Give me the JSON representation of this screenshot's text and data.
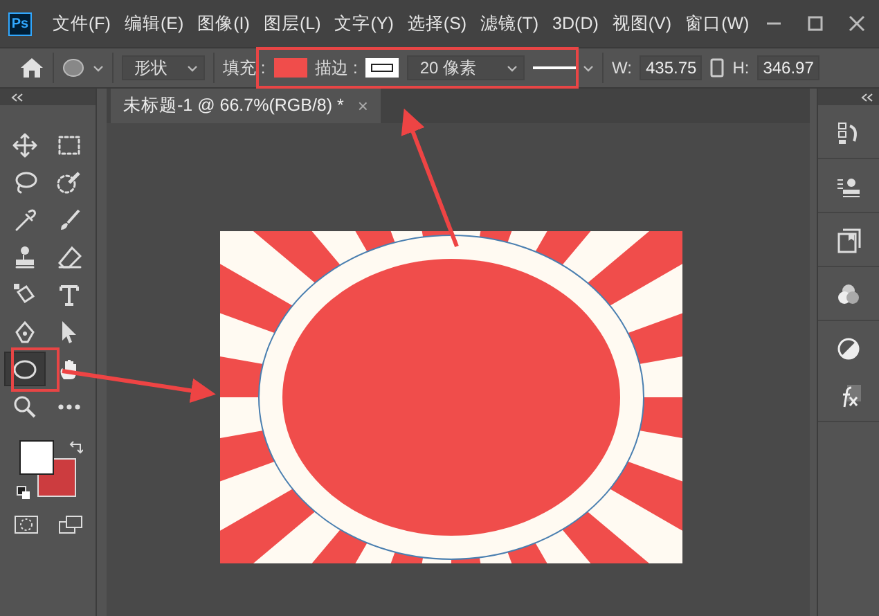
{
  "app": {
    "logo": "Ps"
  },
  "menu": [
    "文件(F)",
    "编辑(E)",
    "图像(I)",
    "图层(L)",
    "文字(Y)",
    "选择(S)",
    "滤镜(T)",
    "3D(D)",
    "视图(V)",
    "窗口(W)"
  ],
  "options_bar": {
    "shape_mode": "形状",
    "fill_label": "填充 :",
    "stroke_label": "描边 :",
    "stroke_width": "20 像素",
    "w_label": "W:",
    "w_value": "435.75",
    "h_label": "H:",
    "h_value": "346.97"
  },
  "tools": [
    {
      "kind": "move",
      "selected": false
    },
    {
      "kind": "marquee",
      "selected": false
    },
    {
      "kind": "lasso",
      "selected": false
    },
    {
      "kind": "quick-select",
      "selected": false
    },
    {
      "kind": "eyedropper",
      "selected": false
    },
    {
      "kind": "brush",
      "selected": false
    },
    {
      "kind": "stamp",
      "selected": false
    },
    {
      "kind": "eraser",
      "selected": false
    },
    {
      "kind": "bucket",
      "selected": false
    },
    {
      "kind": "text",
      "selected": false
    },
    {
      "kind": "pen",
      "selected": false
    },
    {
      "kind": "pointer",
      "selected": false
    },
    {
      "kind": "ellipse",
      "selected": true
    },
    {
      "kind": "hand",
      "selected": false
    },
    {
      "kind": "zoom",
      "selected": false
    },
    {
      "kind": "more",
      "selected": false
    }
  ],
  "document_tab": {
    "title": "未标题-1 @ 66.7%(RGB/8) *",
    "close": "×"
  },
  "right_panel": [
    {
      "kind": "history"
    },
    {
      "kind": "clone-source"
    },
    {
      "kind": "book"
    },
    {
      "kind": "channels"
    },
    {
      "kind": "adjust"
    },
    {
      "kind": "fx"
    }
  ]
}
